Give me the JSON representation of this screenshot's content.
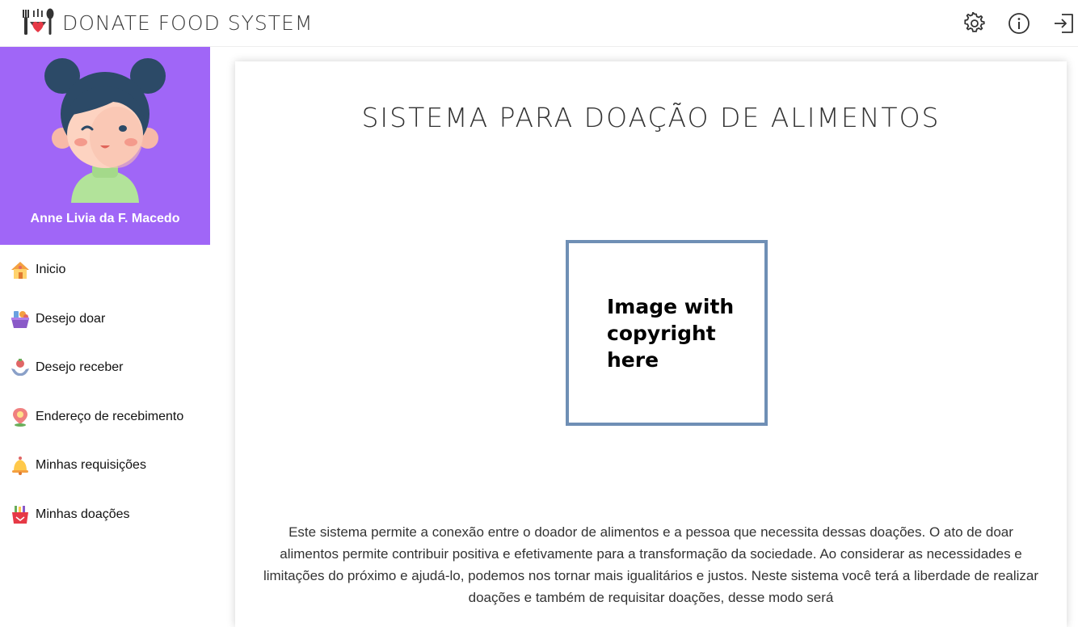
{
  "header": {
    "app_title": "DONATE FOOD SYSTEM",
    "icons": [
      "logo-icon",
      "gear-icon",
      "info-icon",
      "logout-icon"
    ]
  },
  "sidebar": {
    "profile": {
      "name": "Anne Livia da F. Macedo",
      "background_color": "#a066f7"
    },
    "items": [
      {
        "label": "Inicio",
        "icon": "home-icon"
      },
      {
        "label": "Desejo doar",
        "icon": "food-basket-icon"
      },
      {
        "label": "Desejo receber",
        "icon": "hand-receive-icon"
      },
      {
        "label": "Endereço de recebimento",
        "icon": "location-pin-icon"
      },
      {
        "label": "Minhas requisições",
        "icon": "bell-icon"
      },
      {
        "label": "Minhas doações",
        "icon": "shopping-bag-icon"
      }
    ]
  },
  "main": {
    "title": "SISTEMA PARA DOAÇÃO DE ALIMENTOS",
    "image_placeholder_text": "Image with copyright here",
    "description": "Este sistema permite a conexão entre o doador de alimentos e a pessoa que necessita dessas doações. O ato de doar alimentos permite contribuir positiva e efetivamente para a transformação da sociedade. Ao considerar as necessidades e limitações do próximo e ajudá-lo, podemos nos tornar mais igualitários e justos. Neste sistema você terá a liberdade de realizar doações e também de requisitar doações, desse modo será"
  }
}
